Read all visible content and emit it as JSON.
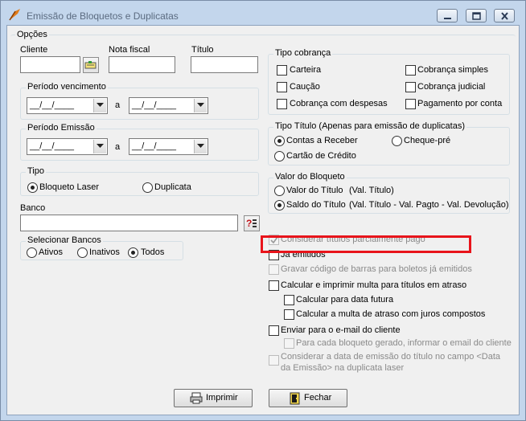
{
  "window": {
    "title": "Emissão de Bloquetos e Duplicatas",
    "icons": {
      "app": "pen-nib-icon",
      "minimize": "minimize-icon",
      "maximize": "maximize-icon",
      "close": "close-icon"
    }
  },
  "opcoes": {
    "title": "Opções",
    "cliente_label": "Cliente",
    "cliente_value": "",
    "nota_fiscal_label": "Nota fiscal",
    "nota_fiscal_value": "",
    "titulo_label": "Título",
    "titulo_value": ""
  },
  "periodo_vencimento": {
    "title": "Período vencimento",
    "from": "__/__/____",
    "separator": "a",
    "to": "__/__/____"
  },
  "periodo_emissao": {
    "title": "Período Emissão",
    "from": "__/__/____",
    "separator": "a",
    "to": "__/__/____"
  },
  "tipo": {
    "title": "Tipo",
    "options": [
      {
        "label": "Bloqueto Laser",
        "selected": true
      },
      {
        "label": "Duplicata",
        "selected": false
      }
    ]
  },
  "banco": {
    "label": "Banco",
    "value": "",
    "lookup_button_icon": "question-list-icon"
  },
  "selecionar_bancos": {
    "title": "Selecionar Bancos",
    "options": [
      {
        "label": "Ativos",
        "selected": false
      },
      {
        "label": "Inativos",
        "selected": false
      },
      {
        "label": "Todos",
        "selected": true
      }
    ]
  },
  "tipo_cobranca": {
    "title": "Tipo cobrança",
    "options": [
      {
        "label": "Carteira",
        "checked": false
      },
      {
        "label": "Cobrança simples",
        "checked": false
      },
      {
        "label": "Caução",
        "checked": false
      },
      {
        "label": "Cobrança judicial",
        "checked": false
      },
      {
        "label": "Cobrança com despesas",
        "checked": false
      },
      {
        "label": "Pagamento por conta",
        "checked": false
      }
    ]
  },
  "tipo_titulo": {
    "title": "Tipo Título (Apenas para emissão de duplicatas)",
    "options": [
      {
        "label": "Contas a Receber",
        "selected": true
      },
      {
        "label": "Cheque-pré",
        "selected": false
      },
      {
        "label": "Cartão de Crédito",
        "selected": false
      }
    ]
  },
  "valor_bloqueto": {
    "title": "Valor do Bloqueto",
    "options": [
      {
        "label": "Valor do Título",
        "detail": "(Val. Título)",
        "selected": false
      },
      {
        "label": "Saldo do Título",
        "detail": "(Val. Título - Val. Pagto - Val. Devolução)",
        "selected": true
      }
    ]
  },
  "checks": {
    "parcialmente_pago": {
      "label": "Considerar títulos parcialmente pago",
      "checked": true,
      "enabled": false
    },
    "ja_emitidos": {
      "label": "Já emitidos",
      "checked": false,
      "enabled": true
    },
    "gravar_codigo": {
      "label": "Gravar código de barras para boletos já emitidos",
      "checked": false,
      "enabled": false
    },
    "calcular_multa": {
      "label": "Calcular e imprimir multa para títulos em atraso",
      "checked": false,
      "enabled": true
    },
    "data_futura": {
      "label": "Calcular para data futura",
      "checked": false,
      "enabled": true
    },
    "juros_compostos": {
      "label": "Calcular a multa de atraso com juros compostos",
      "checked": false,
      "enabled": true
    },
    "enviar_email": {
      "label": "Enviar para o e-mail do cliente",
      "checked": false,
      "enabled": true
    },
    "cada_bloqueto": {
      "label": "Para cada bloqueto gerado, informar o email do cliente",
      "checked": false,
      "enabled": false
    },
    "data_emissao_line1": "Considerar a data de emissão do título no campo <Data",
    "data_emissao_line2": "da Emissão> na duplicata laser"
  },
  "buttons": {
    "imprimir": "Imprimir",
    "fechar": "Fechar"
  },
  "colors": {
    "highlight": "#e8141b",
    "window_frame": "#c3d6ec",
    "client_bg": "#f0f0f0"
  }
}
